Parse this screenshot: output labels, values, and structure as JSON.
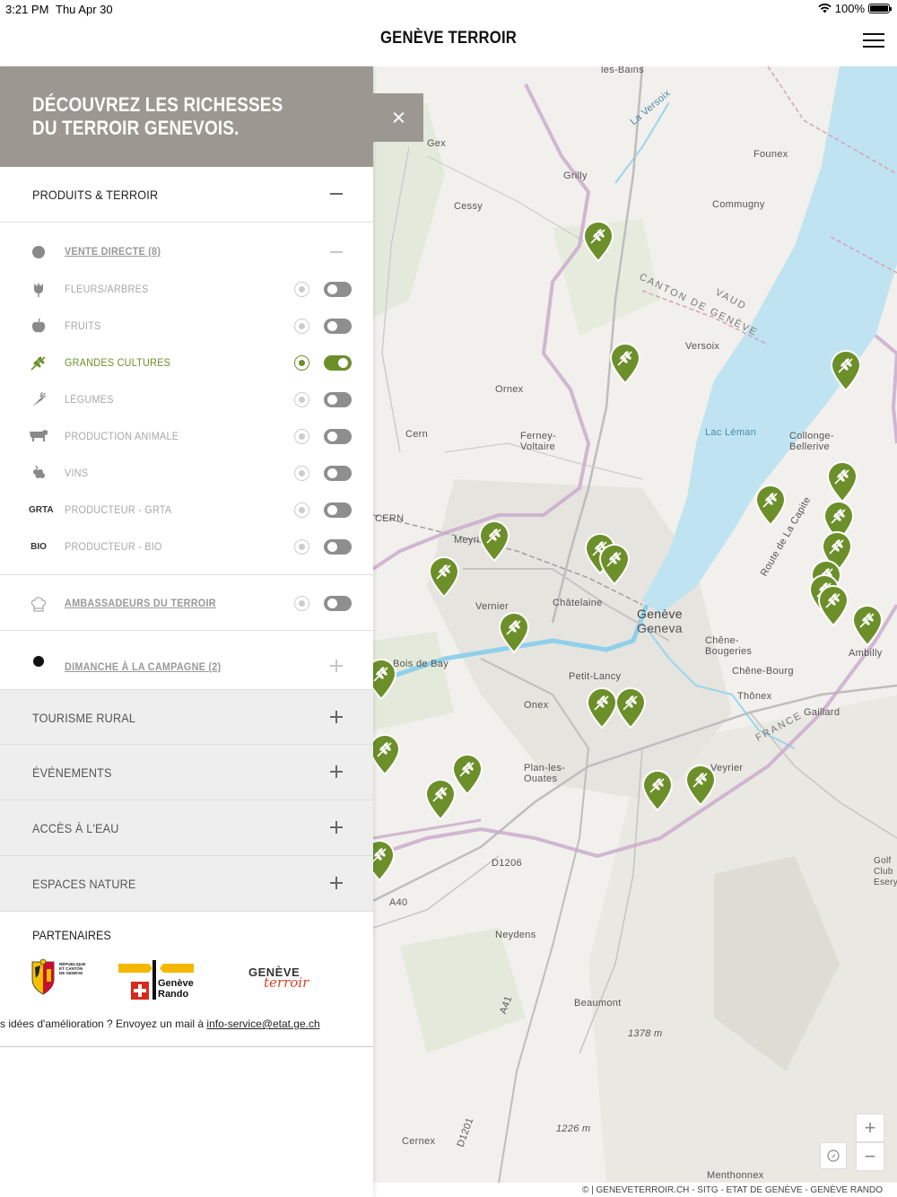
{
  "status_bar": {
    "time": "3:21 PM",
    "date": "Thu Apr 30",
    "battery": "100%"
  },
  "header": {
    "brand": "GENÈVE TERROIR"
  },
  "panel": {
    "title": "DÉCOUVREZ LES RICHESSES DU TERROIR GENEVOIS.",
    "sections": {
      "produits": "PRODUITS & TERROIR",
      "tourisme": "TOURISME RURAL",
      "evenements": "ÉVÉNEMENTS",
      "eau": "ACCÈS À L'EAU",
      "nature": "ESPACES NATURE"
    },
    "vente_directe": "VENTE DIRECTE (8)",
    "items": [
      {
        "label": "FLEURS/ARBRES",
        "icon": "flower-icon",
        "on": false
      },
      {
        "label": "FRUITS",
        "icon": "apple-icon",
        "on": false
      },
      {
        "label": "GRANDES CULTURES",
        "icon": "wheat-icon",
        "on": true
      },
      {
        "label": "LÉGUMES",
        "icon": "carrot-icon",
        "on": false
      },
      {
        "label": "PRODUCTION ANIMALE",
        "icon": "cow-icon",
        "on": false
      },
      {
        "label": "VINS",
        "icon": "grapes-icon",
        "on": false
      },
      {
        "label": "PRODUCTEUR - GRTA",
        "icon": "grta-icon",
        "icon_text": "GRTA",
        "on": false
      },
      {
        "label": "PRODUCTEUR - BIO",
        "icon": "bio-icon",
        "icon_text": "BIO",
        "on": false
      }
    ],
    "ambassadeurs": "AMBASSADEURS DU TERROIR",
    "dimanche": "DIMANCHE À LA CAMPAGNE (2)",
    "partners_title": "PARTENAIRES",
    "partner_logos": {
      "republique": [
        "RÉPUBLIQUE",
        "ET CANTON",
        "DE GENÈVE"
      ],
      "rando": [
        "Genève",
        "Rando"
      ],
      "terroir": [
        "GENÈVE",
        "terroir"
      ]
    },
    "feedback_text": "s idées d'amélioration ? Envoyez un mail à ",
    "feedback_email": "info-service@etat.ge.ch"
  },
  "map": {
    "labels": [
      "les-Bains",
      "Gex",
      "Grilly",
      "Founex",
      "Cessy",
      "Commugny",
      "CANTON DE GENÈVE",
      "VAUD",
      "Versoix",
      "Ornex",
      "Cern",
      "Ferney-Voltaire",
      "Lac Léman",
      "Collonge-Bellerive",
      "Meyrin",
      "Châtelaine",
      "Genève",
      "Geneva",
      "Vernier",
      "Chêne-Bougeries",
      "Chêne-Bourg",
      "Petit-Lancy",
      "Onex",
      "Thônex",
      "Gaillard",
      "FRANCE",
      "Plan-les-Ouates",
      "Ambilly",
      "Neydens",
      "Beaumont",
      "1378 m",
      "1226 m",
      "Cernex",
      "Menthonnex",
      "Bois de Bay",
      "Golf Club Esery",
      "A40",
      "A41",
      "D1206",
      "D1201",
      "Route de La Capite",
      "Veyrier",
      "La Versoix",
      "CERN"
    ],
    "pins": 25,
    "zoom_in": "+",
    "zoom_out": "−",
    "attribution": "© | GENEVETERROIR.CH - SITG - ETAT DE GENÈVE - GENÈVE RANDO"
  },
  "colors": {
    "accent": "#6c8f2a",
    "panel_header": "#9c9891",
    "lake": "#bfe3f1"
  }
}
